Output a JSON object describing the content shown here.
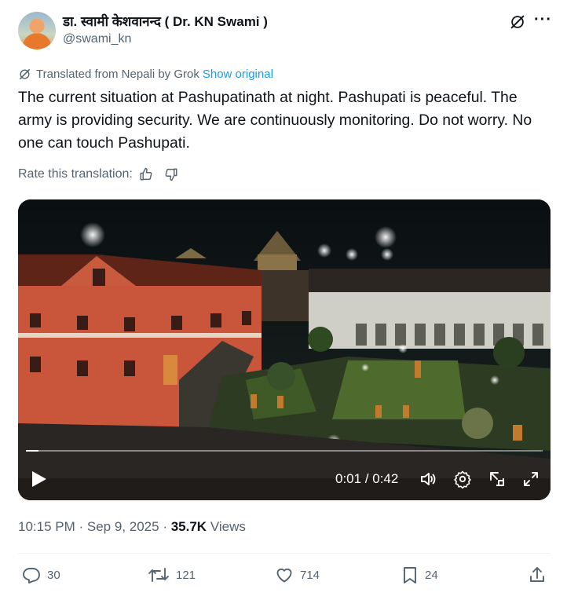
{
  "author": {
    "display_name": "डा. स्वामी केशवानन्द ( Dr. KN Swami )",
    "handle": "@swami_kn"
  },
  "translation": {
    "notice": "Translated from Nepali by Grok",
    "show_original": "Show original",
    "rate_label": "Rate this translation:"
  },
  "tweet": {
    "text": "The current situation at Pashupatinath at night. Pashupati is peaceful. The army is providing security. We are continuously monitoring. Do not worry. No one can touch Pashupati."
  },
  "video": {
    "time": "0:01 / 0:42",
    "progress": 0.024
  },
  "meta": {
    "time": "10:15 PM",
    "date": "Sep 9, 2025",
    "views_count": "35.7K",
    "views_label": "Views"
  },
  "actions": {
    "replies": "30",
    "reposts": "121",
    "likes": "714",
    "bookmarks": "24"
  },
  "colors": {
    "accent": "#1d9bf0",
    "secondary_text": "#536471"
  }
}
